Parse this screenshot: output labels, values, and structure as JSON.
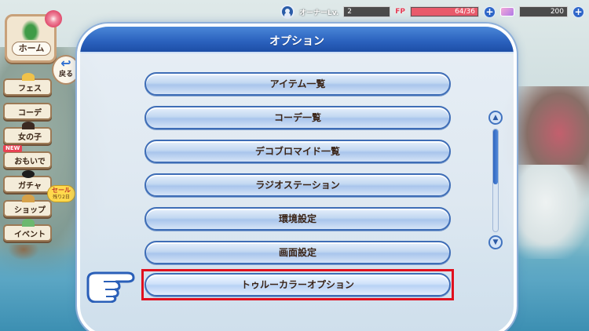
{
  "topbar": {
    "owner_label": "オーナーLv.",
    "owner_level": "2",
    "fp_label": "FP",
    "fp_value": "64/36",
    "fp_fill_percent": 100,
    "gems_value": "200",
    "plus_symbol": "+"
  },
  "nav": {
    "home_label": "ホーム",
    "back_label": "戻る",
    "back_arrow": "↩",
    "items": [
      {
        "label": "フェス"
      },
      {
        "label": "コーデ"
      },
      {
        "label": "女の子"
      },
      {
        "label": "おもいで"
      },
      {
        "label": "ガチャ"
      },
      {
        "label": "ショップ"
      },
      {
        "label": "イベント"
      }
    ],
    "new_tag": "NEW",
    "sale_badge": "セール",
    "sale_remaining": "残り2日"
  },
  "panel": {
    "title": "オプション",
    "options": [
      "アイテム一覧",
      "コーデ一覧",
      "デコブロマイド一覧",
      "ラジオステーション",
      "環境設定",
      "画面設定",
      "トゥルーカラーオプション"
    ],
    "scroll_up": "▲",
    "scroll_down": "▼"
  },
  "colors": {
    "panel_header": "#2a61bd",
    "highlight_frame": "#e0101e",
    "button_border": "#3e6db6",
    "fp_bar": "#e95b6b"
  }
}
